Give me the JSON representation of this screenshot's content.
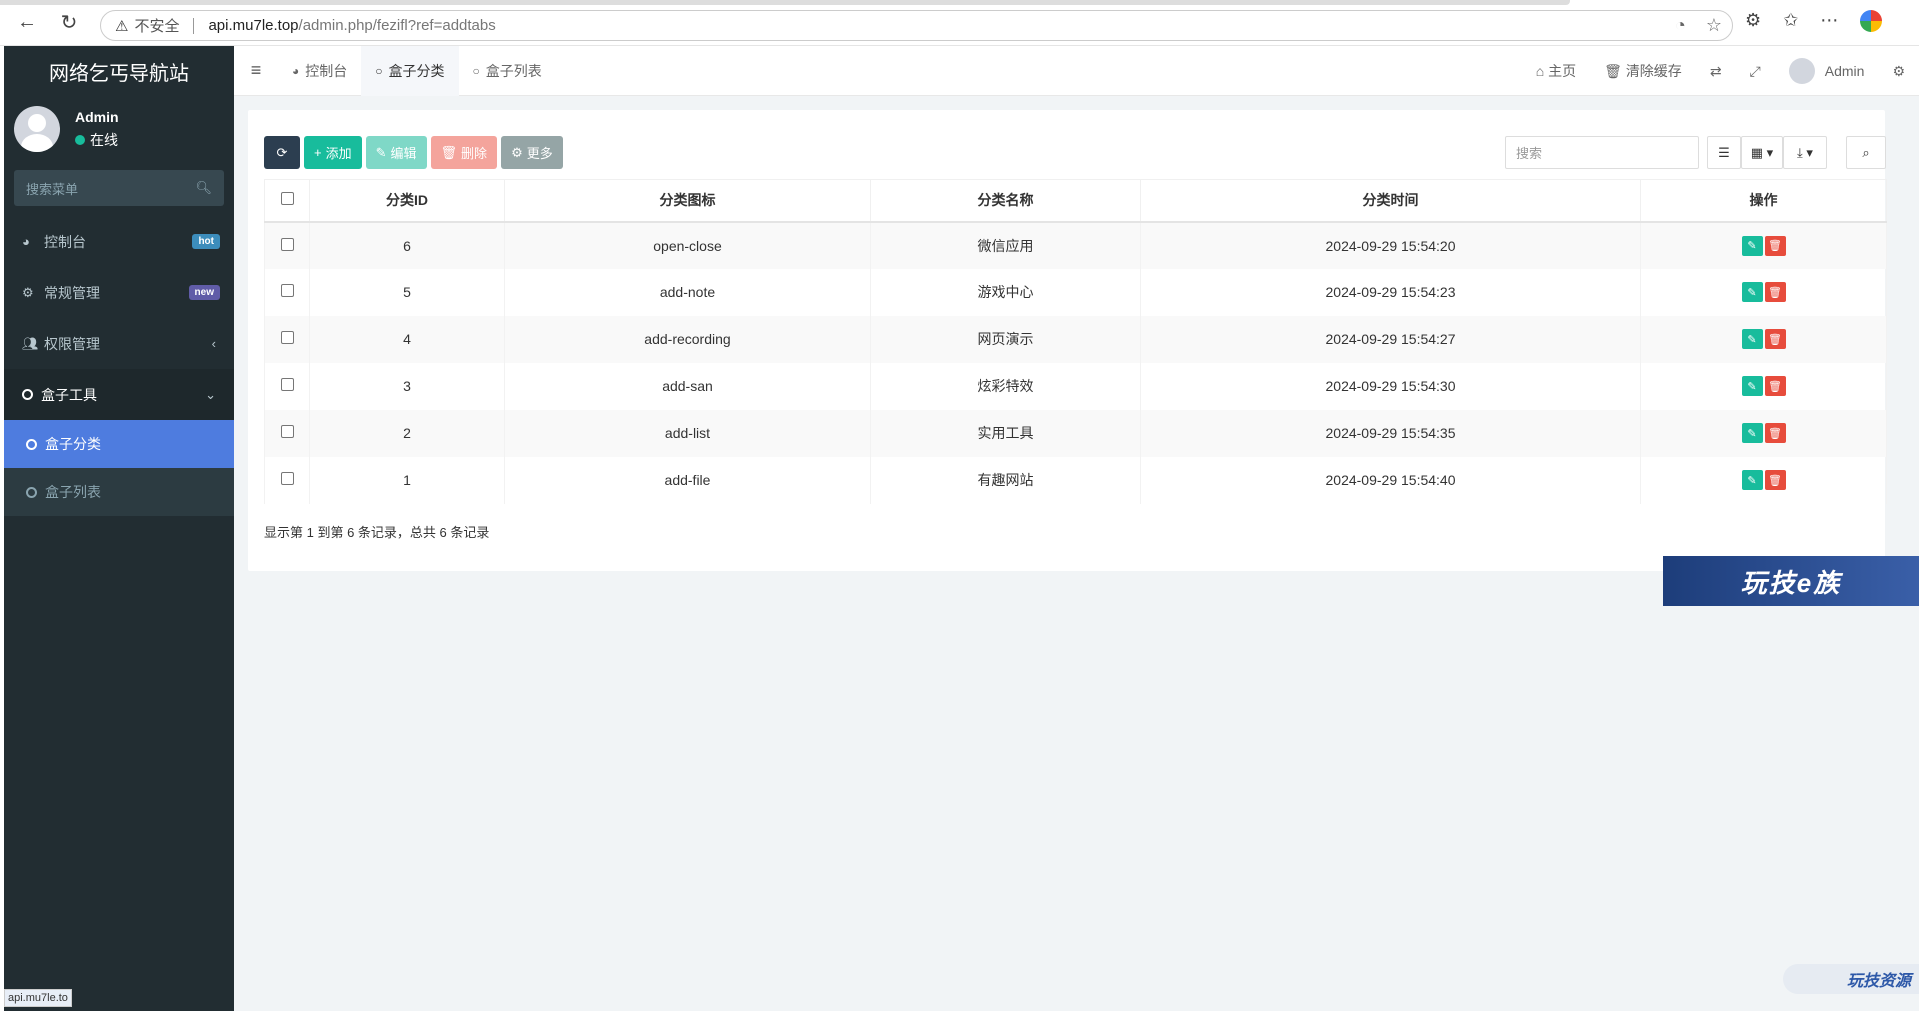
{
  "browser": {
    "insecure_label": "不安全",
    "url_host": "api.mu7le.top",
    "url_path": "/admin.php/fezifl?ref=addtabs"
  },
  "sidebar": {
    "logo": "网络乞丐导航站",
    "user": {
      "name": "Admin",
      "status": "在线"
    },
    "search_placeholder": "搜索菜单",
    "items": [
      {
        "label": "控制台",
        "badge": "hot"
      },
      {
        "label": "常规管理",
        "badge": "new"
      },
      {
        "label": "权限管理"
      },
      {
        "label": "盒子工具"
      }
    ],
    "submenu": [
      {
        "label": "盒子分类"
      },
      {
        "label": "盒子列表"
      }
    ]
  },
  "topnav": {
    "tabs": [
      {
        "label": "控制台"
      },
      {
        "label": "盒子分类"
      },
      {
        "label": "盒子列表"
      }
    ],
    "home": "主页",
    "clear_cache": "清除缓存",
    "user": "Admin"
  },
  "toolbar": {
    "add": "添加",
    "edit": "编辑",
    "delete": "删除",
    "more": "更多",
    "search_placeholder": "搜索"
  },
  "table": {
    "headers": [
      "分类ID",
      "分类图标",
      "分类名称",
      "分类时间",
      "操作"
    ],
    "rows": [
      {
        "id": "6",
        "icon": "open-close",
        "name": "微信应用",
        "time": "2024-09-29 15:54:20"
      },
      {
        "id": "5",
        "icon": "add-note",
        "name": "游戏中心",
        "time": "2024-09-29 15:54:23"
      },
      {
        "id": "4",
        "icon": "add-recording",
        "name": "网页演示",
        "time": "2024-09-29 15:54:27"
      },
      {
        "id": "3",
        "icon": "add-san",
        "name": "炫彩特效",
        "time": "2024-09-29 15:54:30"
      },
      {
        "id": "2",
        "icon": "add-list",
        "name": "实用工具",
        "time": "2024-09-29 15:54:35"
      },
      {
        "id": "1",
        "icon": "add-file",
        "name": "有趣网站",
        "time": "2024-09-29 15:54:40"
      }
    ],
    "pager_text": "显示第 1 到第 6 条记录，总共 6 条记录"
  },
  "status_bar": "api.mu7le.to",
  "watermarks": {
    "banner": "玩技e族",
    "corner": "玩技资源"
  }
}
